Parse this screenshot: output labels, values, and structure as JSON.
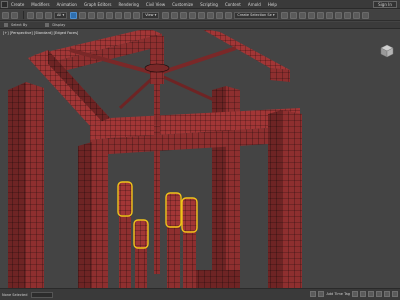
{
  "menubar": {
    "items": [
      "Create",
      "Modifiers",
      "Animation",
      "Graph Editors",
      "Rendering",
      "Civil View",
      "Customize",
      "Scripting",
      "Content",
      "Arnold",
      "Help"
    ],
    "signin_label": "Sign In"
  },
  "toolbar": {
    "dropdown_all": "All",
    "dropdown_view": "View",
    "dropdown_selection": "Create Selection Se"
  },
  "ribbon": {
    "labels": [
      "Select By",
      "Display"
    ]
  },
  "viewport": {
    "label": "[+] [Perspective] [Standard] [Edged Faces]"
  },
  "statusbar": {
    "left_text": "None Selected",
    "time_tag": "Add Time Tag"
  },
  "colors": {
    "model": "#8e2f2f",
    "selected_highlight": "#f0c419"
  }
}
